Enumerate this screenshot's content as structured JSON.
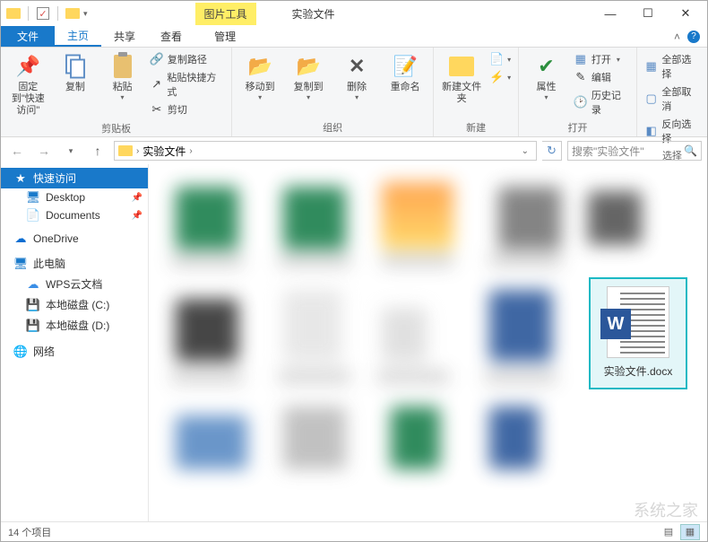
{
  "titlebar": {
    "contextual_tab": "图片工具",
    "window_title": "实验文件"
  },
  "win_controls": {
    "min": "—",
    "max": "☐",
    "close": "✕"
  },
  "tabs": {
    "file": "文件",
    "home": "主页",
    "share": "共享",
    "view": "查看",
    "manage": "管理"
  },
  "ribbon": {
    "clipboard": {
      "pin": "固定到\"快速访问\"",
      "copy": "复制",
      "paste": "粘贴",
      "copy_path": "复制路径",
      "paste_shortcut": "粘贴快捷方式",
      "cut": "剪切",
      "label": "剪贴板"
    },
    "organize": {
      "move_to": "移动到",
      "copy_to": "复制到",
      "delete": "删除",
      "rename": "重命名",
      "label": "组织"
    },
    "new": {
      "new_folder": "新建文件夹",
      "label": "新建"
    },
    "open": {
      "properties": "属性",
      "open": "打开",
      "edit": "编辑",
      "history": "历史记录",
      "label": "打开"
    },
    "select": {
      "select_all": "全部选择",
      "select_none": "全部取消",
      "invert": "反向选择",
      "label": "选择"
    }
  },
  "address": {
    "crumb1": "实验文件",
    "search_placeholder": "搜索\"实验文件\""
  },
  "nav": {
    "quick_access": "快速访问",
    "desktop": "Desktop",
    "documents": "Documents",
    "onedrive": "OneDrive",
    "this_pc": "此电脑",
    "wps": "WPS云文档",
    "disk_c": "本地磁盘 (C:)",
    "disk_d": "本地磁盘 (D:)",
    "network": "网络"
  },
  "selected_file": {
    "name": "实验文件.docx",
    "badge": "W"
  },
  "status": {
    "count": "14 个项目"
  },
  "watermark": "系统之家"
}
